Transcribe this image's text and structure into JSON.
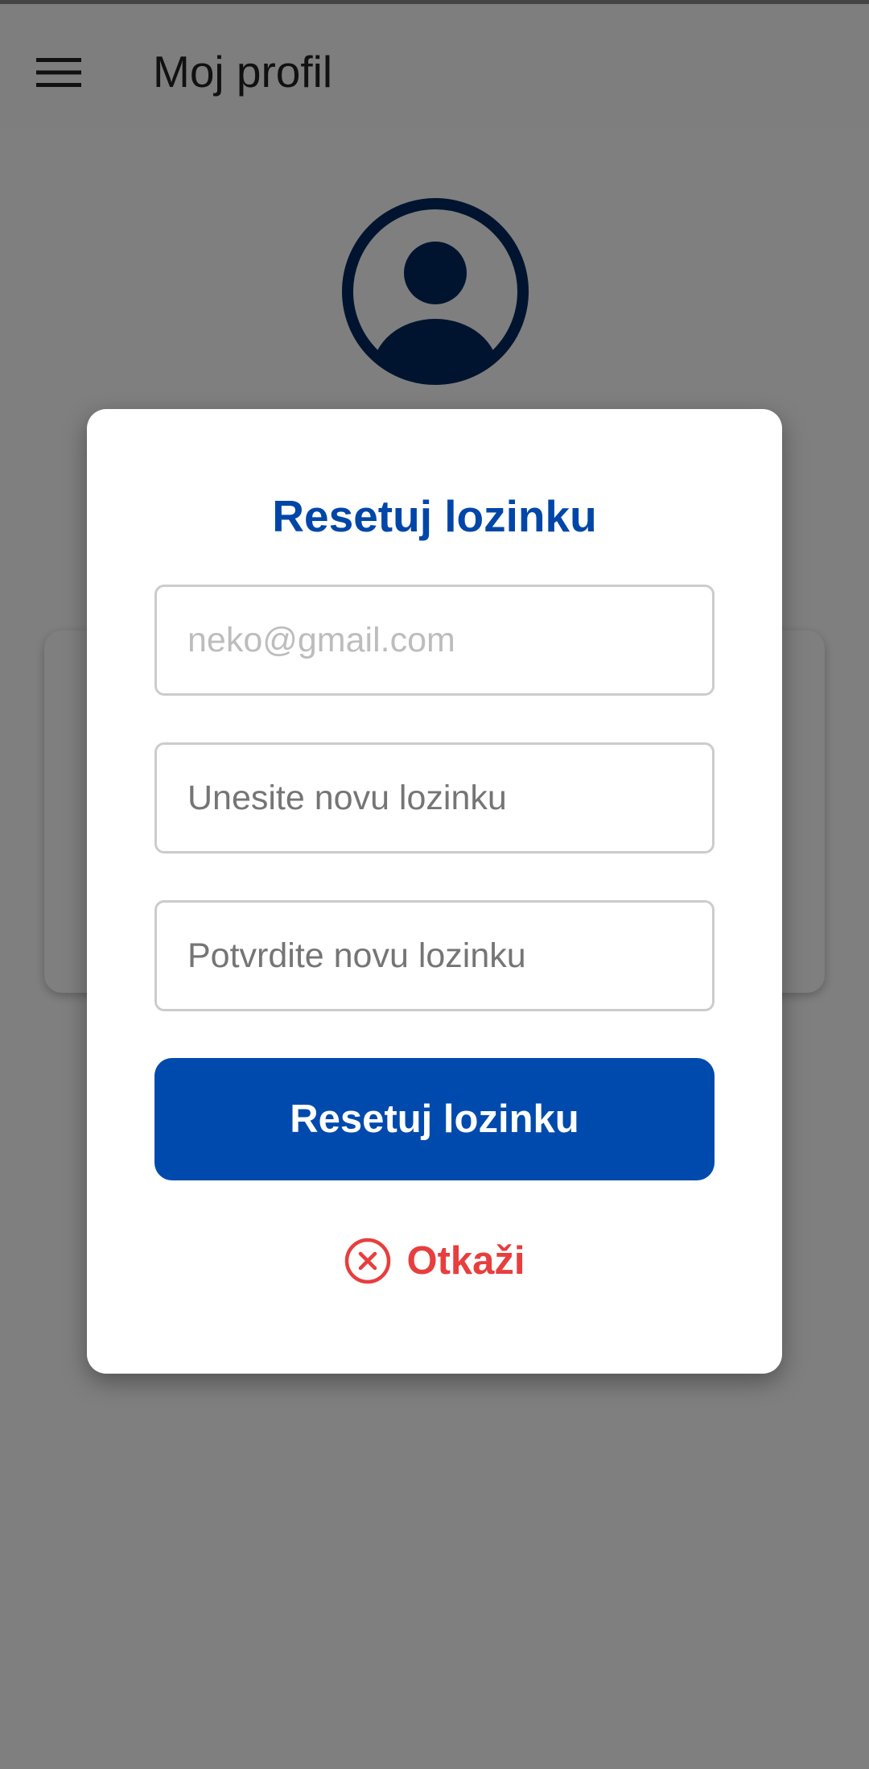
{
  "header": {
    "menu_icon": "hamburger-menu-icon",
    "title": "Moj profil"
  },
  "profile": {
    "avatar_icon": "user-avatar-icon",
    "avatar_color": "#00285e"
  },
  "reset_dialog": {
    "title": "Resetuj lozinku",
    "email_placeholder": "neko@gmail.com",
    "new_password_placeholder": "Unesite novu lozinku",
    "confirm_password_placeholder": "Potvrdite novu lozinku",
    "submit_label": "Resetuj lozinku",
    "cancel_icon": "close-circle-icon",
    "cancel_label": "Otkaži"
  },
  "colors": {
    "primary": "#004aad",
    "title_blue": "#0046a8",
    "cancel_red": "#e83e3e",
    "scrim": "rgba(0,0,0,0.5)"
  }
}
